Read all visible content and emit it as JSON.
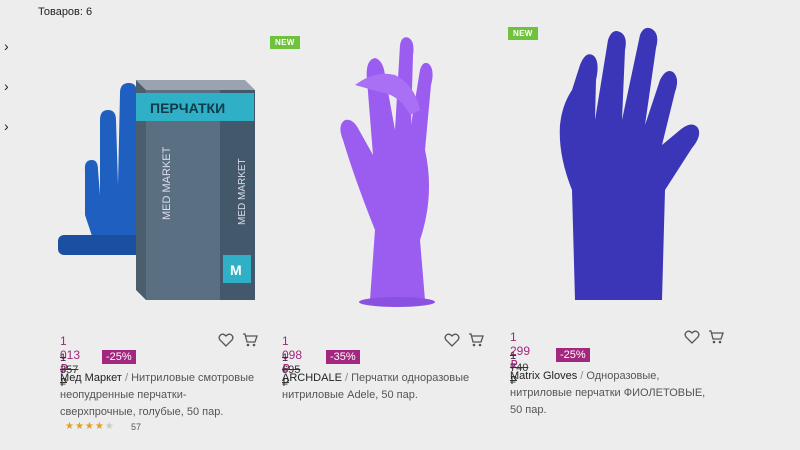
{
  "header": {
    "products_count_label": "Товаров: 6"
  },
  "filters": {
    "chevrons": [
      "chevron-right-icon",
      "chevron-right-icon",
      "chevron-right-icon"
    ]
  },
  "products": [
    {
      "price": "1 013 ₽",
      "old_price": "1 357 ₽",
      "discount": "-25%",
      "brand": "Мед Маркет",
      "sep": " / ",
      "desc_line1": "Нитриловые смотровые",
      "desc_line2": "неопудренные перчатки-",
      "desc_line3": "сверхпрочные, голубые, 50 пар.",
      "rating_stars": 4,
      "reviews": "57",
      "box_title": "ПЕРЧАТКИ",
      "box_brand": "MED MARKET",
      "box_size": "M",
      "glove_color": "#1f5fbf"
    },
    {
      "badge": "NEW",
      "price": "1 098 ₽",
      "old_price": "1 695 ₽",
      "discount": "-35%",
      "brand": "ARCHDALE",
      "sep": " / ",
      "desc_line1": "Перчатки одноразовые",
      "desc_line2": "нитриловые Adele, 50 пар.",
      "glove_color": "#9b5cf0"
    },
    {
      "badge": "NEW",
      "price": "1 299 ₽",
      "old_price": "1 740 ₽",
      "discount": "-25%",
      "brand": "Matrix Gloves",
      "sep": " / ",
      "desc_line1": "Одноразовые,",
      "desc_line2": "нитриловые перчатки ФИОЛЕТОВЫЕ,",
      "desc_line3": "50 пар.",
      "glove_color": "#3b35b8"
    }
  ],
  "colors": {
    "accent": "#a3277e",
    "badge_new": "#6fc23c"
  }
}
